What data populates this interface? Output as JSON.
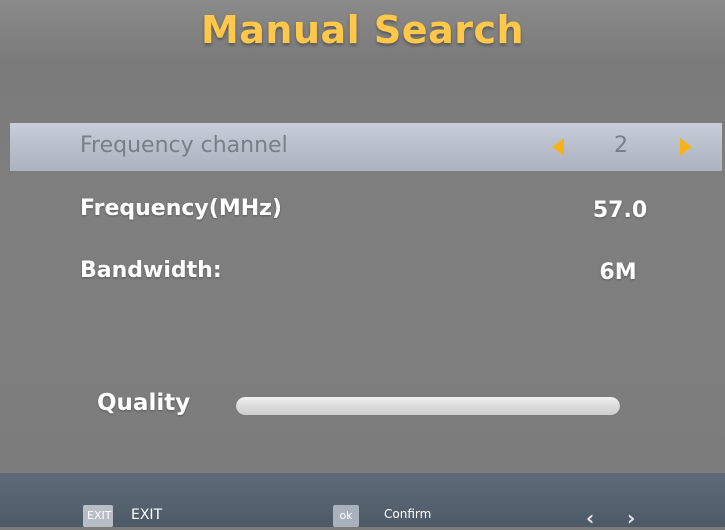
{
  "header": {
    "title": "Manual Search"
  },
  "settings": {
    "frequency_channel": {
      "label": "Frequency channel",
      "value": "2"
    },
    "frequency": {
      "label": "Frequency(MHz)",
      "value": "57.0"
    },
    "bandwidth": {
      "label": "Bandwidth:",
      "value": "6M"
    }
  },
  "quality": {
    "label": "Quality",
    "level": 1.0
  },
  "footer": {
    "exit_badge": "EXIT",
    "exit_label": "EXIT",
    "ok_badge": "ok",
    "confirm_label": "Confirm"
  },
  "icons": {
    "left_arrow": "left-arrow-icon",
    "right_arrow": "right-arrow-icon"
  },
  "colors": {
    "title": "#ffc84a",
    "arrow_accent": "#f5b21a",
    "highlight_row": "#b9bfca",
    "footer_bar": "#566370"
  }
}
